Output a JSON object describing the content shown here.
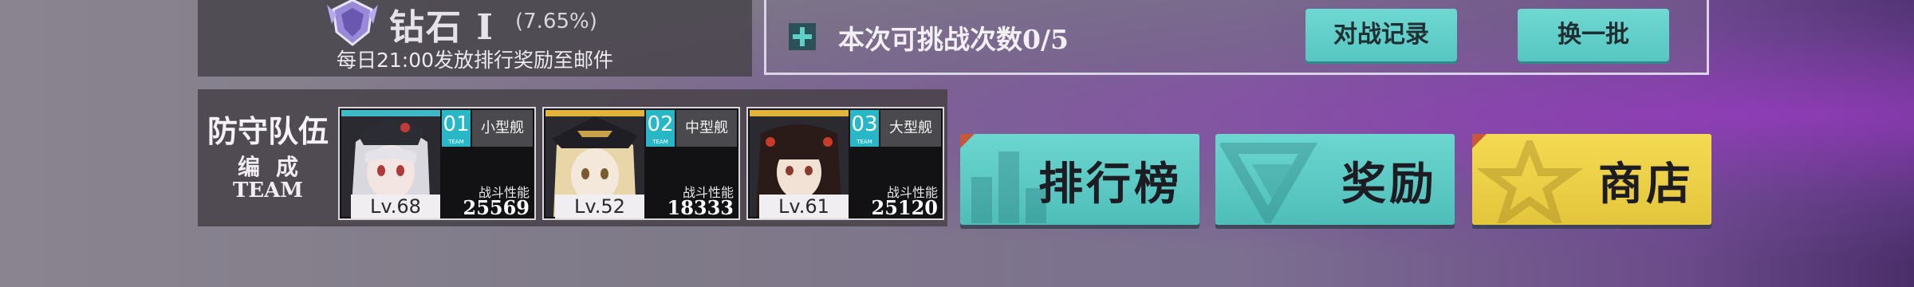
{
  "rank": {
    "icon": "rank-crest-icon",
    "name": "钻石 I",
    "percent": "(7.65%)",
    "reward_note": "每日21:00发放排行奖励至邮件"
  },
  "challenge": {
    "icon": "plus-icon",
    "text": "本次可挑战次数0/5",
    "battle_record_label": "对战记录",
    "refresh_label": "换一批"
  },
  "defense_team": {
    "title": "防守队伍",
    "subtitle": "编成",
    "subtitle_en": "TEAM",
    "perf_label": "战斗性能",
    "members": [
      {
        "slot": "01",
        "slot_tag": "TEAM",
        "ship_type": "小型舰",
        "level": "Lv.68",
        "performance": "25569",
        "accent": "#3fb9c8"
      },
      {
        "slot": "02",
        "slot_tag": "TEAM",
        "ship_type": "中型舰",
        "level": "Lv.52",
        "performance": "18333",
        "accent": "#e0b43a"
      },
      {
        "slot": "03",
        "slot_tag": "TEAM",
        "ship_type": "大型舰",
        "level": "Lv.61",
        "performance": "25120",
        "accent": "#e0b43a"
      }
    ]
  },
  "nav_buttons": [
    {
      "label": "排行榜",
      "icon": "bar-chart-icon",
      "color": "#5fcfca"
    },
    {
      "label": "奖励",
      "icon": "triangle-emblem-icon",
      "color": "#5fcfca"
    },
    {
      "label": "商店",
      "icon": "star-icon",
      "color": "#f2d54a"
    }
  ]
}
